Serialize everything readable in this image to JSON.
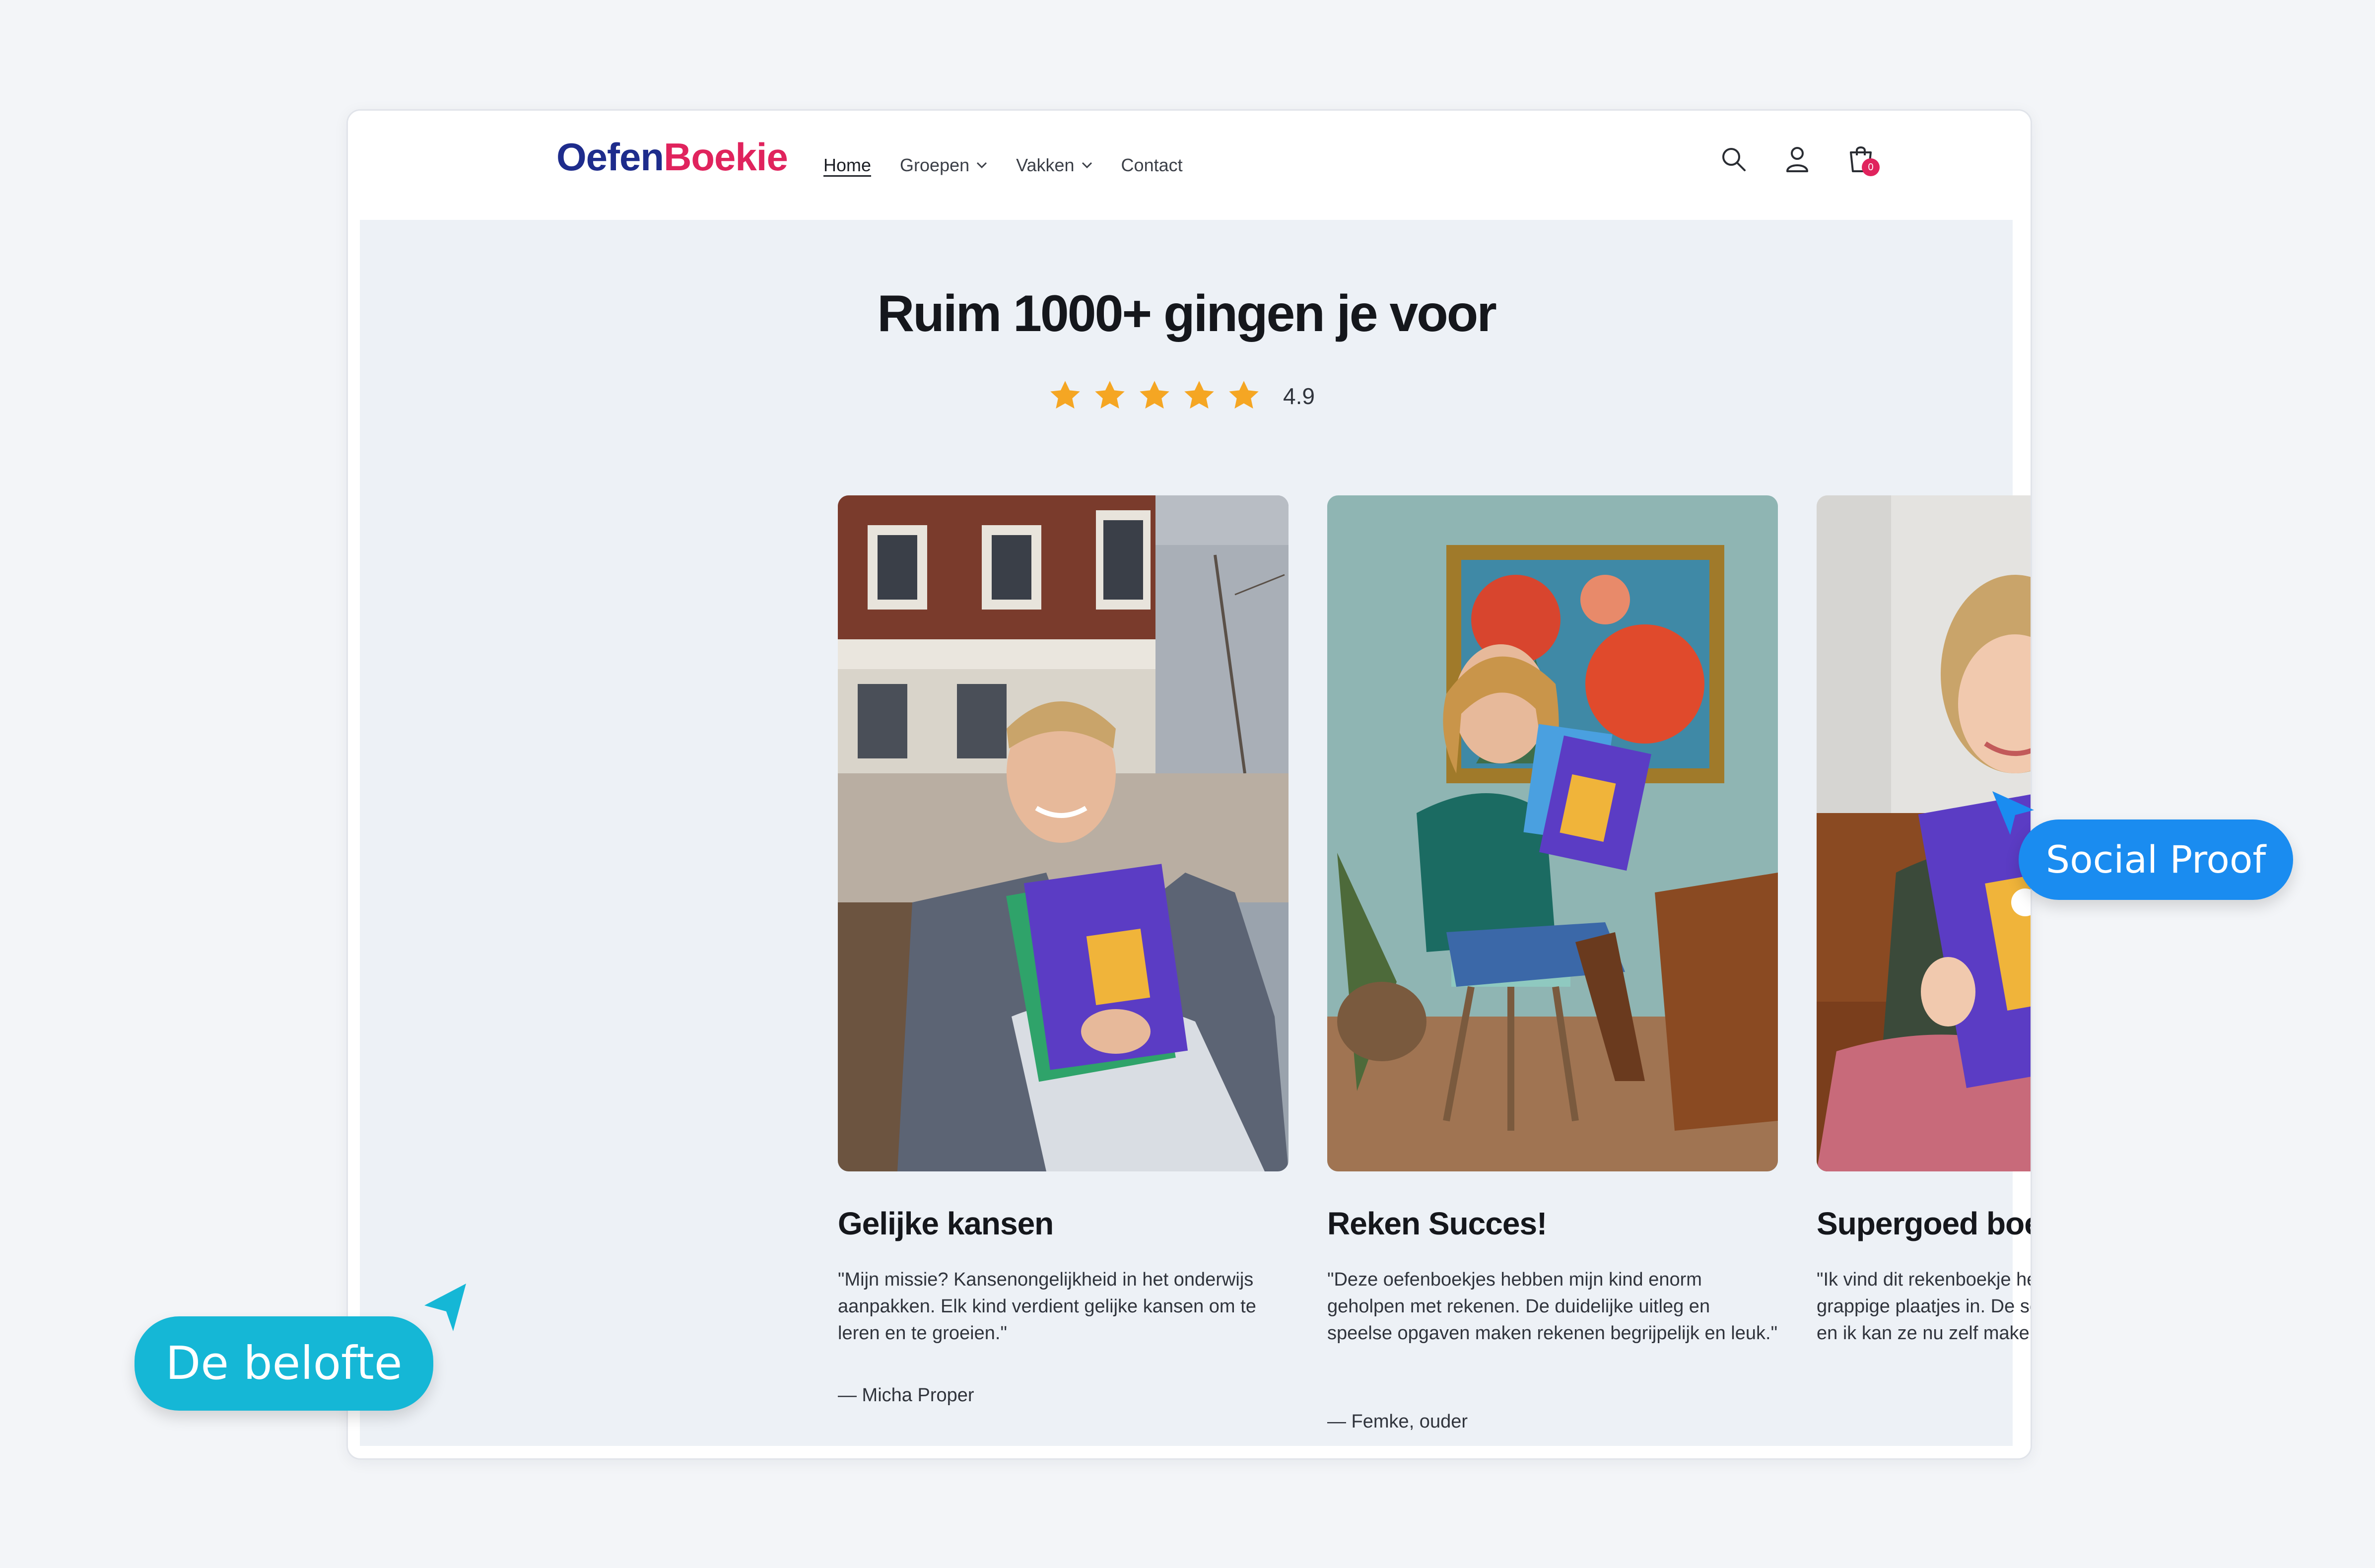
{
  "header": {
    "logo_part1": "Oefen",
    "logo_part2": "Boekie",
    "nav": [
      {
        "label": "Home"
      },
      {
        "label": "Groepen"
      },
      {
        "label": "Vakken"
      },
      {
        "label": "Contact"
      }
    ],
    "icons": [
      "search-icon",
      "account-icon",
      "cart-icon"
    ],
    "cart_count": "0"
  },
  "section": {
    "title": "Ruim 1000+ gingen je voor",
    "rating": 4.9,
    "rating_text": "4.9",
    "stars": 5
  },
  "cards": [
    {
      "title": "Gelijke kansen",
      "quote": "\"Mijn missie? Kansenongelijkheid in het onderwijs aanpakken. Elk kind verdient gelijke kansen om te leren en te groeien.\"",
      "author": "— Micha Proper"
    },
    {
      "title": "Reken Succes!",
      "quote": "\"Deze oefenboekjes hebben mijn kind enorm geholpen met rekenen. De duidelijke uitleg en speelse opgaven maken rekenen begrijpelijk en leuk.\"",
      "author": "— Femke, ouder"
    },
    {
      "title": "Supergoed boekje!",
      "quote": "\"Ik vind dit rekenboekje heel leuk want er staan grappige plaatjes in. De sommen zijn niet te moeilijk en ik kan ze nu zelf maken.\""
    }
  ],
  "annotations": {
    "social": "Social Proof",
    "belofte": "De belofte"
  },
  "colors": {
    "brand_blue": "#1e2c8c",
    "brand_pink": "#e0235d",
    "star": "#f5a623",
    "pill_social": "#1a8cf0",
    "pill_belofte": "#15b7d6"
  }
}
